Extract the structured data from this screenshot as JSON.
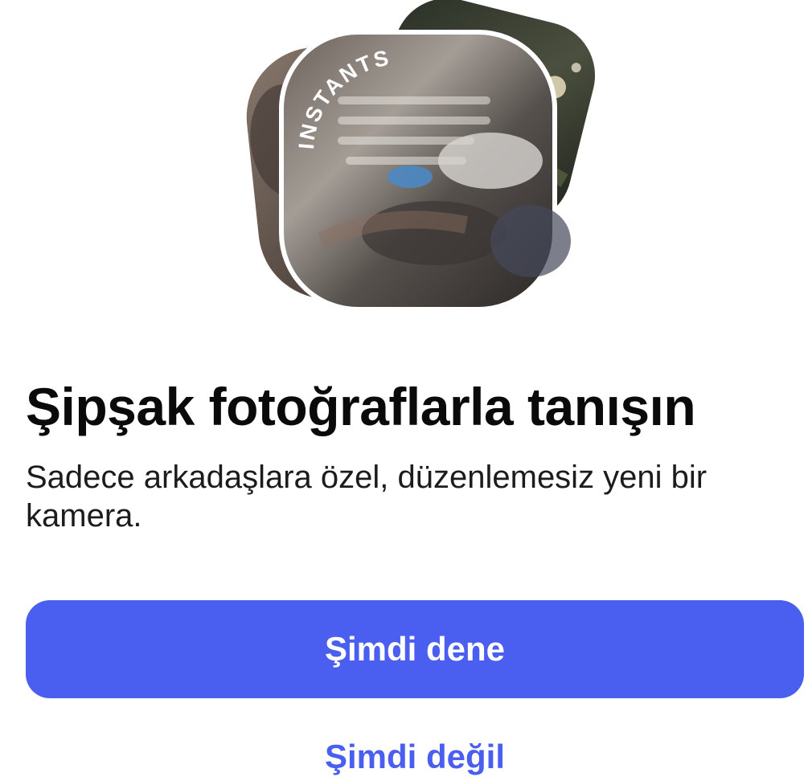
{
  "hero": {
    "badge_text": "INSTANTS",
    "icon": "instants-photo-stack-illustration"
  },
  "intro": {
    "title": "Şipşak fotoğraflarla tanışın",
    "subtitle": "Sadece arkadaşlara özel, düzenlemesiz yeni bir kamera."
  },
  "actions": {
    "primary_label": "Şimdi dene",
    "secondary_label": "Şimdi değil"
  },
  "colors": {
    "accent": "#4a5ff0",
    "title_text": "#0a0a0a",
    "body_text": "#1c1c1c",
    "background": "#ffffff"
  }
}
